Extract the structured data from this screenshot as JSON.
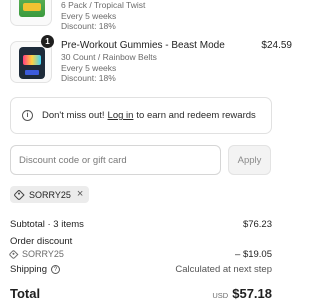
{
  "items": [
    {
      "variant": "6 Pack / Tropical Twist",
      "frequency": "Every 5 weeks",
      "discount": "Discount: 18%"
    },
    {
      "title": "Pre-Workout Gummies - Beast Mode",
      "price": "$24.59",
      "quantity": "1",
      "variant": "30 Count / Rainbow Belts",
      "frequency": "Every 5 weeks",
      "discount": "Discount: 18%"
    }
  ],
  "notice": {
    "before": "Don't miss out!",
    "link": "Log in",
    "after": "to earn and redeem rewards"
  },
  "discount_form": {
    "placeholder": "Discount code or gift card",
    "apply_label": "Apply"
  },
  "applied_code": "SORRY25",
  "summary": {
    "subtotal_label": "Subtotal · 3 items",
    "subtotal_value": "$76.23",
    "order_discount_label": "Order discount",
    "discount_code": "SORRY25",
    "discount_value": "– $19.05",
    "shipping_label": "Shipping",
    "shipping_value": "Calculated at next step",
    "total_label": "Total",
    "currency": "USD",
    "total_value": "$57.18"
  }
}
